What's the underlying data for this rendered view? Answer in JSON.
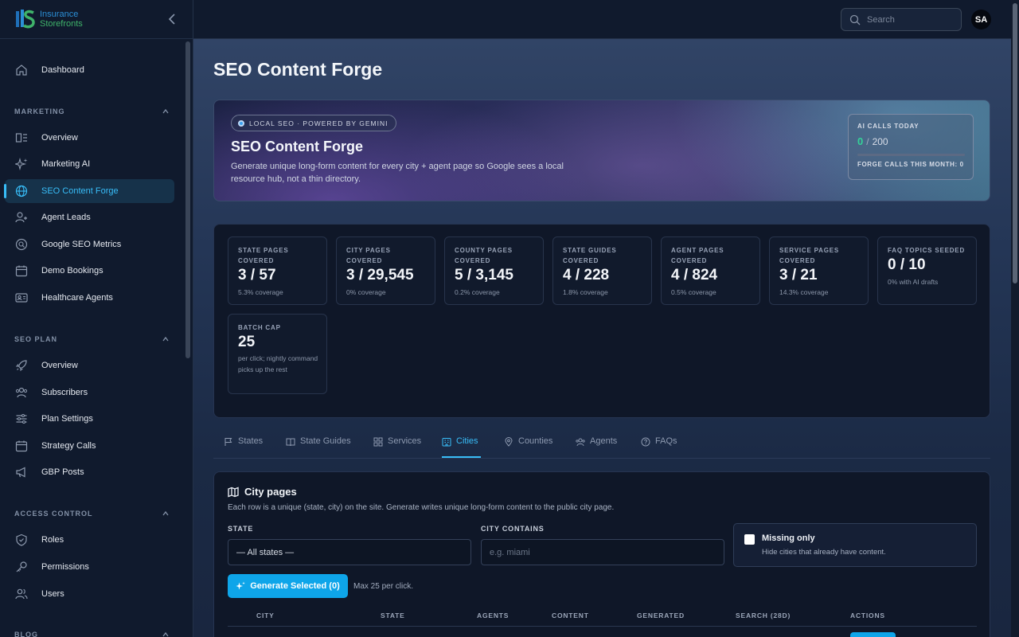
{
  "logo": {
    "line1": "Insurance",
    "line2": "Storefronts"
  },
  "sidebar": {
    "dashboard": "Dashboard",
    "sections": [
      {
        "title": "MARKETING",
        "items": [
          "Overview",
          "Marketing AI",
          "SEO Content Forge",
          "Agent Leads",
          "Google SEO Metrics",
          "Demo Bookings",
          "Healthcare Agents"
        ]
      },
      {
        "title": "SEO PLAN",
        "items": [
          "Overview",
          "Subscribers",
          "Plan Settings",
          "Strategy Calls",
          "GBP Posts"
        ]
      },
      {
        "title": "ACCESS CONTROL",
        "items": [
          "Roles",
          "Permissions",
          "Users"
        ]
      },
      {
        "title": "BLOG"
      }
    ],
    "active": "SEO Content Forge",
    "icons": [
      "home-icon",
      "layout-icon",
      "sparkles-icon",
      "globe-icon",
      "user-plus-icon",
      "search-icon",
      "calendar-icon",
      "id-card-icon",
      "rocket-icon",
      "users-icon",
      "sliders-icon",
      "calendar-icon",
      "megaphone-icon",
      "shield-icon",
      "key-icon",
      "users-icon"
    ]
  },
  "header": {
    "search_placeholder": "Search",
    "avatar": "SA"
  },
  "page": {
    "title": "SEO Content Forge"
  },
  "hero": {
    "pill": "LOCAL SEO · POWERED BY GEMINI",
    "title": "SEO Content Forge",
    "desc": "Generate unique long-form content for every city + agent page so Google sees a local resource hub, not a thin directory.",
    "ai_label": "AI CALLS TODAY",
    "ai_used": "0",
    "ai_sep": "/",
    "ai_limit": "200",
    "ai_fraction": 0,
    "month_label": "FORGE CALLS THIS MONTH:",
    "month_value": "0"
  },
  "stats": [
    {
      "label": "STATE PAGES COVERED",
      "value": "3 / 57",
      "sub": "5.3% coverage"
    },
    {
      "label": "CITY PAGES COVERED",
      "value": "3 / 29,545",
      "sub": "0% coverage"
    },
    {
      "label": "COUNTY PAGES COVERED",
      "value": "5 / 3,145",
      "sub": "0.2% coverage"
    },
    {
      "label": "STATE GUIDES COVERED",
      "value": "4 / 228",
      "sub": "1.8% coverage"
    },
    {
      "label": "AGENT PAGES COVERED",
      "value": "4 / 824",
      "sub": "0.5% coverage"
    },
    {
      "label": "SERVICE PAGES COVERED",
      "value": "3 / 21",
      "sub": "14.3% coverage"
    },
    {
      "label": "FAQ TOPICS SEEDED",
      "value": "0 / 10",
      "sub": "0% with AI drafts"
    },
    {
      "label": "BATCH CAP",
      "value": "25",
      "sub": "per click; nightly command picks up the rest"
    }
  ],
  "tabs": [
    "States",
    "State Guides",
    "Services",
    "Cities",
    "Counties",
    "Agents",
    "FAQs"
  ],
  "active_tab": "Cities",
  "panel": {
    "title": "City pages",
    "desc": "Each row is a unique (state, city) on the site. Generate writes unique long-form content to the public city page.",
    "state_label": "STATE",
    "state_value": "— All states —",
    "city_label": "CITY CONTAINS",
    "city_placeholder": "e.g. miami",
    "missing_title": "Missing only",
    "missing_sub": "Hide cities that already have content.",
    "generate_label": "Generate Selected (0)",
    "generate_note": "Max 25 per click.",
    "columns": [
      "CITY",
      "STATE",
      "AGENTS",
      "CONTENT",
      "GENERATED",
      "SEARCH (28D)",
      "ACTIONS"
    ]
  },
  "colors": {
    "accent": "#38bdf8",
    "button": "#0ea5e9",
    "success": "#34d399"
  }
}
